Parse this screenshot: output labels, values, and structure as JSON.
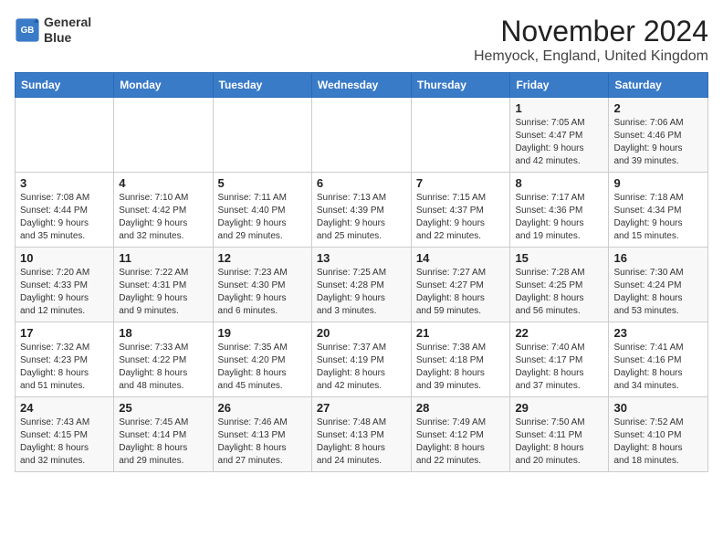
{
  "logo": {
    "line1": "General",
    "line2": "Blue"
  },
  "title": "November 2024",
  "location": "Hemyock, England, United Kingdom",
  "header": {
    "accent_color": "#3a7bc8"
  },
  "days_of_week": [
    "Sunday",
    "Monday",
    "Tuesday",
    "Wednesday",
    "Thursday",
    "Friday",
    "Saturday"
  ],
  "weeks": [
    [
      {
        "day": "",
        "info": ""
      },
      {
        "day": "",
        "info": ""
      },
      {
        "day": "",
        "info": ""
      },
      {
        "day": "",
        "info": ""
      },
      {
        "day": "",
        "info": ""
      },
      {
        "day": "1",
        "info": "Sunrise: 7:05 AM\nSunset: 4:47 PM\nDaylight: 9 hours\nand 42 minutes."
      },
      {
        "day": "2",
        "info": "Sunrise: 7:06 AM\nSunset: 4:46 PM\nDaylight: 9 hours\nand 39 minutes."
      }
    ],
    [
      {
        "day": "3",
        "info": "Sunrise: 7:08 AM\nSunset: 4:44 PM\nDaylight: 9 hours\nand 35 minutes."
      },
      {
        "day": "4",
        "info": "Sunrise: 7:10 AM\nSunset: 4:42 PM\nDaylight: 9 hours\nand 32 minutes."
      },
      {
        "day": "5",
        "info": "Sunrise: 7:11 AM\nSunset: 4:40 PM\nDaylight: 9 hours\nand 29 minutes."
      },
      {
        "day": "6",
        "info": "Sunrise: 7:13 AM\nSunset: 4:39 PM\nDaylight: 9 hours\nand 25 minutes."
      },
      {
        "day": "7",
        "info": "Sunrise: 7:15 AM\nSunset: 4:37 PM\nDaylight: 9 hours\nand 22 minutes."
      },
      {
        "day": "8",
        "info": "Sunrise: 7:17 AM\nSunset: 4:36 PM\nDaylight: 9 hours\nand 19 minutes."
      },
      {
        "day": "9",
        "info": "Sunrise: 7:18 AM\nSunset: 4:34 PM\nDaylight: 9 hours\nand 15 minutes."
      }
    ],
    [
      {
        "day": "10",
        "info": "Sunrise: 7:20 AM\nSunset: 4:33 PM\nDaylight: 9 hours\nand 12 minutes."
      },
      {
        "day": "11",
        "info": "Sunrise: 7:22 AM\nSunset: 4:31 PM\nDaylight: 9 hours\nand 9 minutes."
      },
      {
        "day": "12",
        "info": "Sunrise: 7:23 AM\nSunset: 4:30 PM\nDaylight: 9 hours\nand 6 minutes."
      },
      {
        "day": "13",
        "info": "Sunrise: 7:25 AM\nSunset: 4:28 PM\nDaylight: 9 hours\nand 3 minutes."
      },
      {
        "day": "14",
        "info": "Sunrise: 7:27 AM\nSunset: 4:27 PM\nDaylight: 8 hours\nand 59 minutes."
      },
      {
        "day": "15",
        "info": "Sunrise: 7:28 AM\nSunset: 4:25 PM\nDaylight: 8 hours\nand 56 minutes."
      },
      {
        "day": "16",
        "info": "Sunrise: 7:30 AM\nSunset: 4:24 PM\nDaylight: 8 hours\nand 53 minutes."
      }
    ],
    [
      {
        "day": "17",
        "info": "Sunrise: 7:32 AM\nSunset: 4:23 PM\nDaylight: 8 hours\nand 51 minutes."
      },
      {
        "day": "18",
        "info": "Sunrise: 7:33 AM\nSunset: 4:22 PM\nDaylight: 8 hours\nand 48 minutes."
      },
      {
        "day": "19",
        "info": "Sunrise: 7:35 AM\nSunset: 4:20 PM\nDaylight: 8 hours\nand 45 minutes."
      },
      {
        "day": "20",
        "info": "Sunrise: 7:37 AM\nSunset: 4:19 PM\nDaylight: 8 hours\nand 42 minutes."
      },
      {
        "day": "21",
        "info": "Sunrise: 7:38 AM\nSunset: 4:18 PM\nDaylight: 8 hours\nand 39 minutes."
      },
      {
        "day": "22",
        "info": "Sunrise: 7:40 AM\nSunset: 4:17 PM\nDaylight: 8 hours\nand 37 minutes."
      },
      {
        "day": "23",
        "info": "Sunrise: 7:41 AM\nSunset: 4:16 PM\nDaylight: 8 hours\nand 34 minutes."
      }
    ],
    [
      {
        "day": "24",
        "info": "Sunrise: 7:43 AM\nSunset: 4:15 PM\nDaylight: 8 hours\nand 32 minutes."
      },
      {
        "day": "25",
        "info": "Sunrise: 7:45 AM\nSunset: 4:14 PM\nDaylight: 8 hours\nand 29 minutes."
      },
      {
        "day": "26",
        "info": "Sunrise: 7:46 AM\nSunset: 4:13 PM\nDaylight: 8 hours\nand 27 minutes."
      },
      {
        "day": "27",
        "info": "Sunrise: 7:48 AM\nSunset: 4:13 PM\nDaylight: 8 hours\nand 24 minutes."
      },
      {
        "day": "28",
        "info": "Sunrise: 7:49 AM\nSunset: 4:12 PM\nDaylight: 8 hours\nand 22 minutes."
      },
      {
        "day": "29",
        "info": "Sunrise: 7:50 AM\nSunset: 4:11 PM\nDaylight: 8 hours\nand 20 minutes."
      },
      {
        "day": "30",
        "info": "Sunrise: 7:52 AM\nSunset: 4:10 PM\nDaylight: 8 hours\nand 18 minutes."
      }
    ]
  ]
}
